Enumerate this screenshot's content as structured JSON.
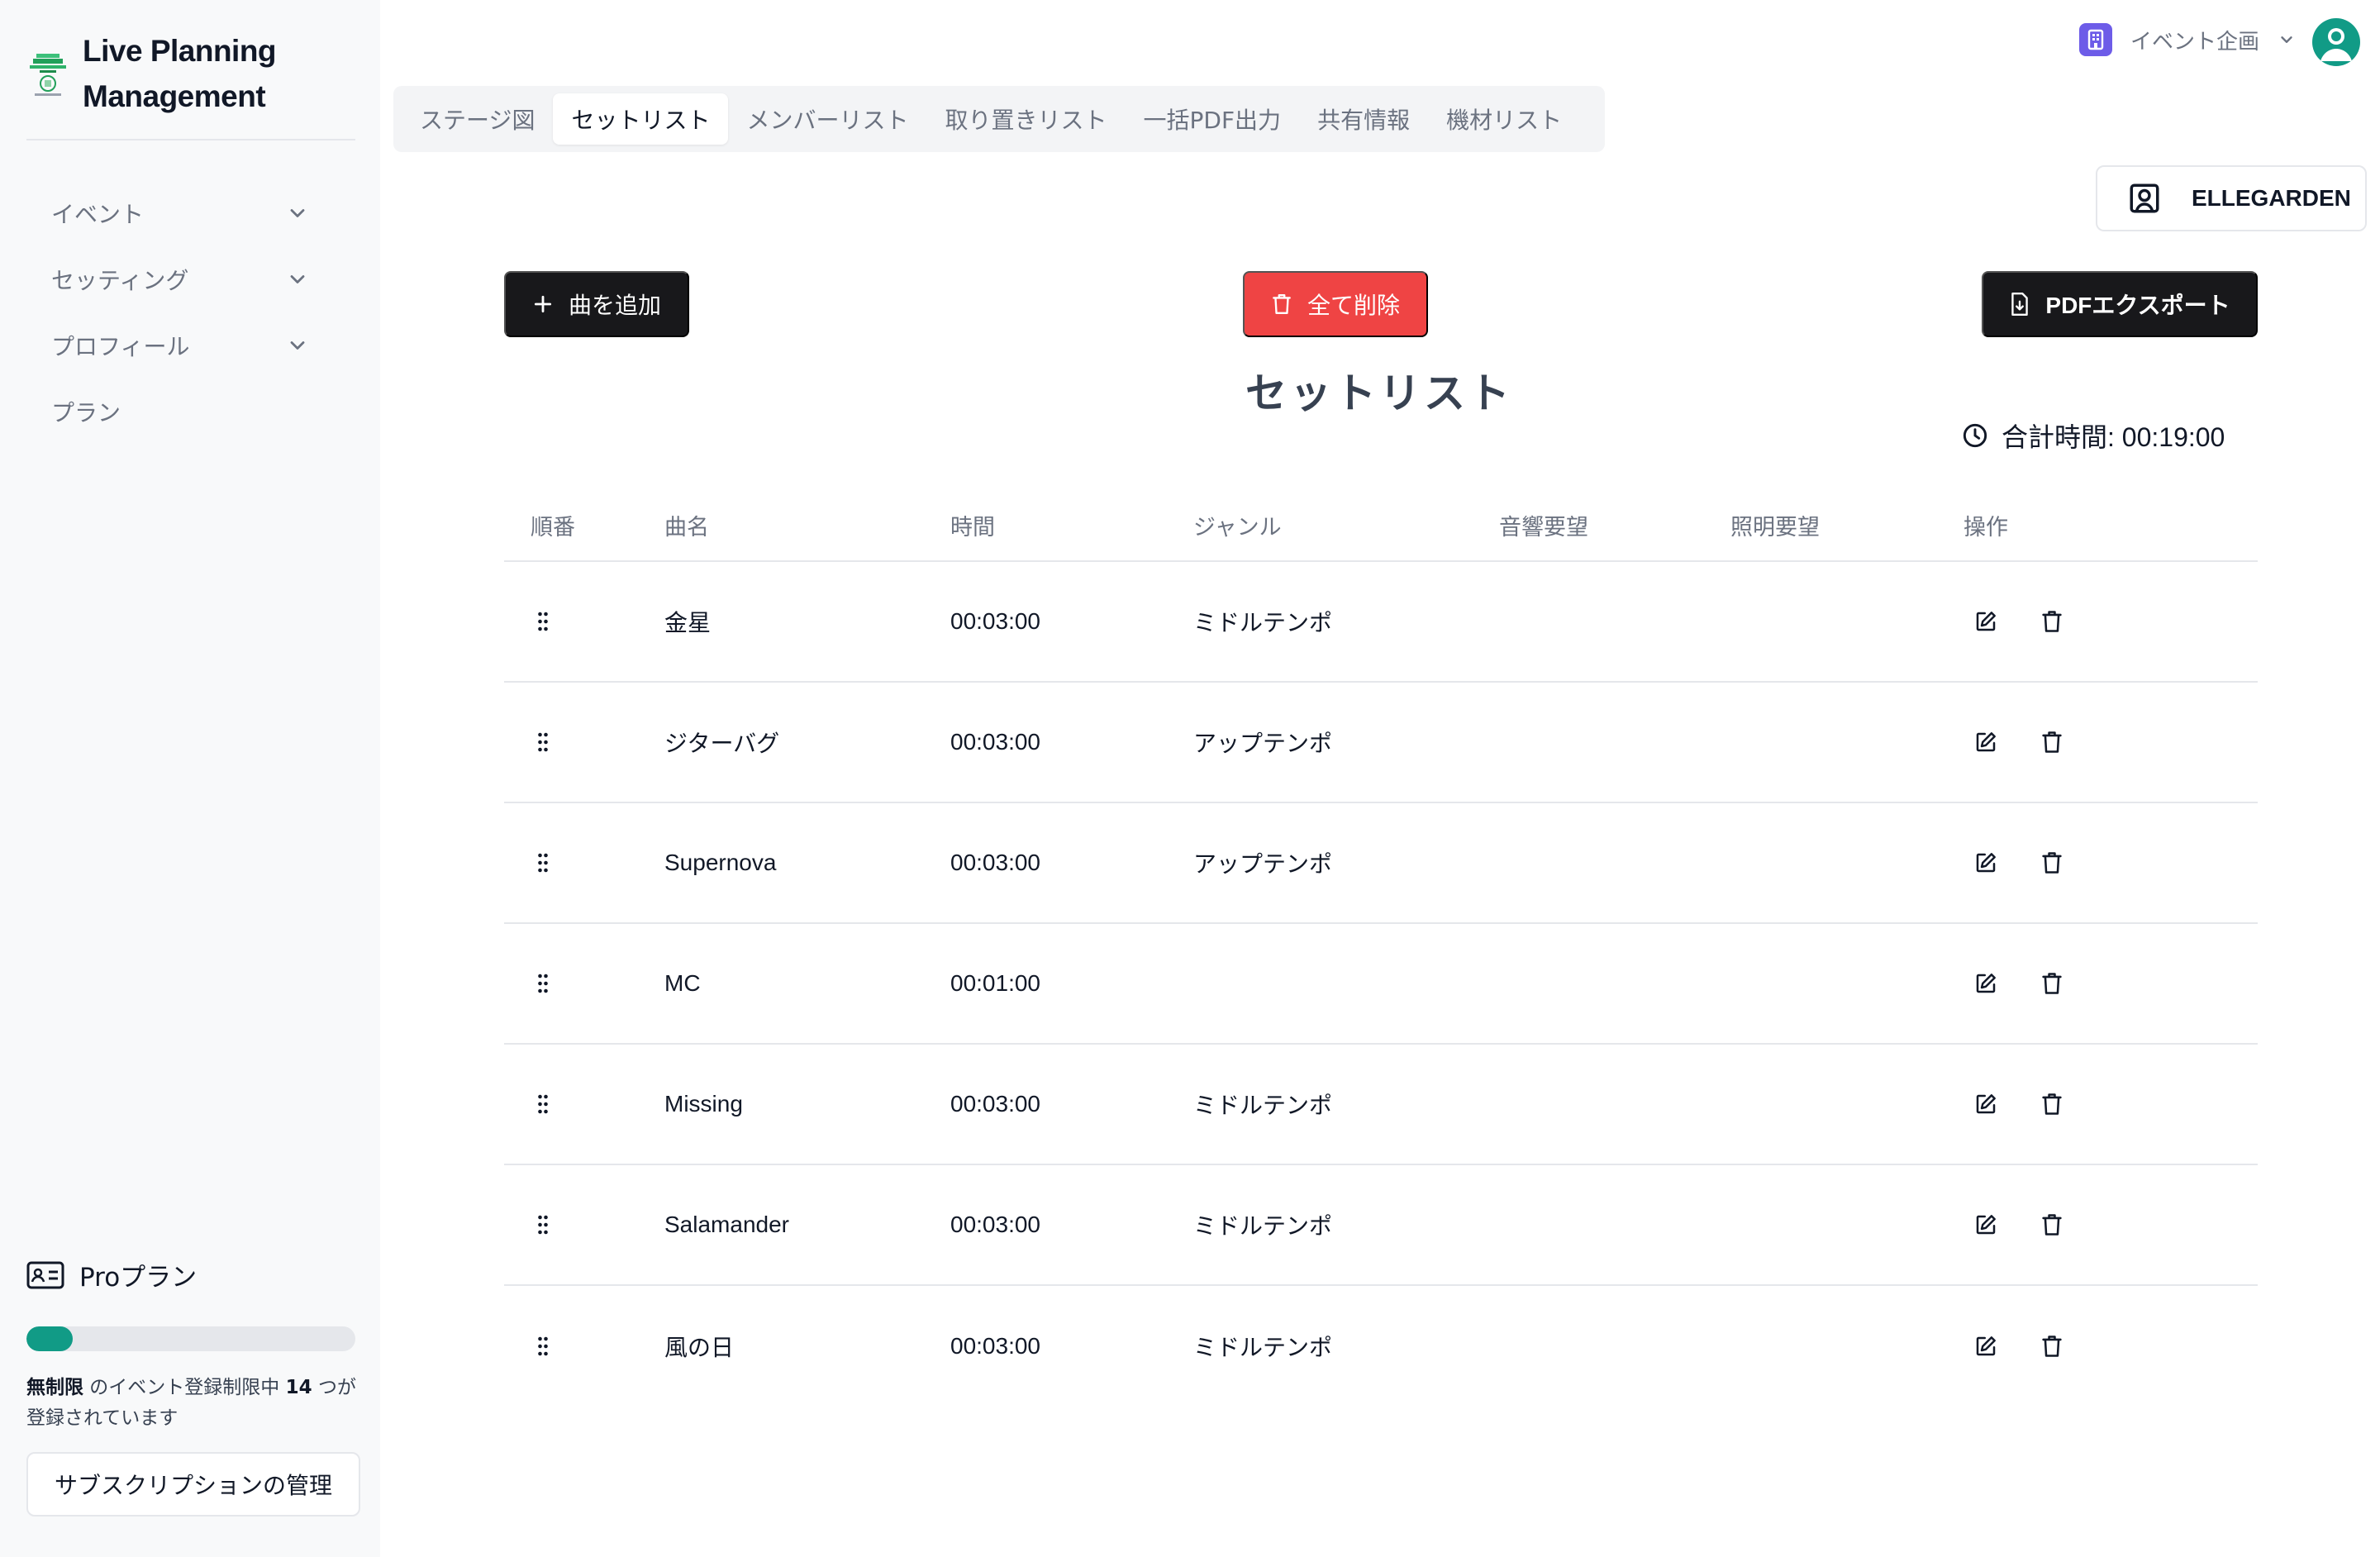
{
  "app": {
    "title_line1": "Live Planning",
    "title_line2": "Management"
  },
  "sidebar": {
    "items": [
      {
        "label": "イベント",
        "has_chevron": true
      },
      {
        "label": "セッティング",
        "has_chevron": true
      },
      {
        "label": "プロフィール",
        "has_chevron": true
      },
      {
        "label": "プラン",
        "has_chevron": false
      }
    ],
    "plan": {
      "name": "Proプラン",
      "usage_fraction": 0.14,
      "limit_label": "無制限",
      "text_middle": " のイベント登録制限中 ",
      "count": "14",
      "text_end": " つが登録されています",
      "manage_label": "サブスクリプションの管理"
    }
  },
  "header": {
    "event_selector": "イベント企画",
    "band": "ELLEGARDEN"
  },
  "tabs": [
    {
      "label": "ステージ図",
      "active": false
    },
    {
      "label": "セットリスト",
      "active": true
    },
    {
      "label": "メンバーリスト",
      "active": false
    },
    {
      "label": "取り置きリスト",
      "active": false
    },
    {
      "label": "一括PDF出力",
      "active": false
    },
    {
      "label": "共有情報",
      "active": false
    },
    {
      "label": "機材リスト",
      "active": false
    }
  ],
  "actions": {
    "add": "曲を追加",
    "delete_all": "全て削除",
    "export": "PDFエクスポート"
  },
  "setlist": {
    "title": "セットリスト",
    "total_label": "合計時間: 00:19:00",
    "columns": [
      "順番",
      "曲名",
      "時間",
      "ジャンル",
      "音響要望",
      "照明要望",
      "操作"
    ],
    "rows": [
      {
        "name": "金星",
        "time": "00:03:00",
        "genre": "ミドルテンポ",
        "sound": "",
        "light": ""
      },
      {
        "name": "ジターバグ",
        "time": "00:03:00",
        "genre": "アップテンポ",
        "sound": "",
        "light": ""
      },
      {
        "name": "Supernova",
        "time": "00:03:00",
        "genre": "アップテンポ",
        "sound": "",
        "light": ""
      },
      {
        "name": "MC",
        "time": "00:01:00",
        "genre": "",
        "sound": "",
        "light": ""
      },
      {
        "name": "Missing",
        "time": "00:03:00",
        "genre": "ミドルテンポ",
        "sound": "",
        "light": ""
      },
      {
        "name": "Salamander",
        "time": "00:03:00",
        "genre": "ミドルテンポ",
        "sound": "",
        "light": ""
      },
      {
        "name": "風の日",
        "time": "00:03:00",
        "genre": "ミドルテンポ",
        "sound": "",
        "light": ""
      }
    ]
  },
  "colors": {
    "accent": "#119b86",
    "danger": "#ef4444",
    "dark": "#18181b",
    "badge": "#6d5ce8"
  }
}
